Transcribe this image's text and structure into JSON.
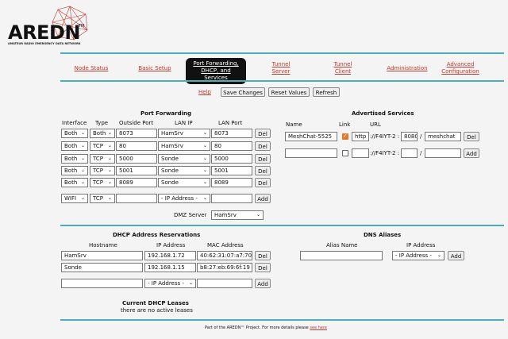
{
  "logo": {
    "wordmark": "AREDN",
    "tm": "TM",
    "tagline": "AMATEUR RADIO EMERGENCY DATA NETWORK"
  },
  "nav": {
    "items": [
      "Node Status",
      "Basic Setup",
      "Port Forwarding, DHCP, and Services",
      "Tunnel Server",
      "Tunnel Client",
      "Administration",
      "Advanced Configuration"
    ],
    "active_index": 2,
    "active_line1": "Port Forwarding,",
    "active_line2": "DHCP, and Services",
    "tunnel_server_1": "Tunnel",
    "tunnel_server_2": "Server",
    "tunnel_client_1": "Tunnel",
    "tunnel_client_2": "Client",
    "advanced_1": "Advanced",
    "advanced_2": "Configuration"
  },
  "actions": {
    "help": "Help",
    "save": "Save Changes",
    "reset": "Reset Values",
    "refresh": "Refresh"
  },
  "port_forwarding": {
    "title": "Port Forwarding",
    "headers": {
      "interface": "Interface",
      "type": "Type",
      "outside": "Outside Port",
      "lan_ip": "LAN IP",
      "lan_port": "LAN Port"
    },
    "rows": [
      {
        "interface": "Both",
        "type": "Both",
        "outside": "8073",
        "lan_ip": "HamSrv",
        "lan_port": "8073"
      },
      {
        "interface": "Both",
        "type": "TCP",
        "outside": "80",
        "lan_ip": "HamSrv",
        "lan_port": "80"
      },
      {
        "interface": "Both",
        "type": "TCP",
        "outside": "5000",
        "lan_ip": "Sonde",
        "lan_port": "5000"
      },
      {
        "interface": "Both",
        "type": "TCP",
        "outside": "5001",
        "lan_ip": "Sonde",
        "lan_port": "5001"
      },
      {
        "interface": "Both",
        "type": "TCP",
        "outside": "8089",
        "lan_ip": "Sonde",
        "lan_port": "8089"
      }
    ],
    "new_row": {
      "interface": "WIFI",
      "type": "TCP",
      "outside": "",
      "lan_ip": "- IP Address -",
      "lan_port": ""
    },
    "del": "Del",
    "add": "Add",
    "dmz_label": "DMZ Server",
    "dmz_value": "HamSrv"
  },
  "advertised": {
    "title": "Advertised Services",
    "headers": {
      "name": "Name",
      "link": "Link",
      "url": "URL"
    },
    "rows": [
      {
        "name": "MeshChat-5525",
        "checked": true,
        "proto": "http",
        "host": "://F4IYT-2 :",
        "port": "8080",
        "sep": "/",
        "path": "meshchat",
        "btn": "Del"
      },
      {
        "name": "",
        "checked": false,
        "proto": "",
        "host": "://F4IYT-2 :",
        "port": "",
        "sep": "/",
        "path": "",
        "btn": "Add"
      }
    ]
  },
  "dhcp": {
    "title": "DHCP Address Reservations",
    "headers": {
      "hostname": "Hostname",
      "ip": "IP Address",
      "mac": "MAC Address"
    },
    "rows": [
      {
        "hostname": "HamSrv",
        "ip": "192.168.1.72",
        "mac": "40:62:31:07:a7:70"
      },
      {
        "hostname": "Sonde",
        "ip": "192.168.1.15",
        "mac": "b8:27:eb:69:6f:19"
      }
    ],
    "new_ip": "- IP Address -",
    "del": "Del",
    "add": "Add",
    "leases_title": "Current DHCP Leases",
    "leases_text": "there are no active leases"
  },
  "dns": {
    "title": "DNS Aliases",
    "headers": {
      "alias": "Alias Name",
      "ip": "IP Address"
    },
    "new_ip": "- IP Address -",
    "add": "Add"
  },
  "footer": {
    "text": "Part of the AREDN™ Project. For more details please",
    "link": "see here"
  },
  "colors": {
    "accent": "#4ab0b8",
    "link": "#c0392b",
    "nav_active_bg": "#111111",
    "checkbox_on": "#e87722"
  }
}
